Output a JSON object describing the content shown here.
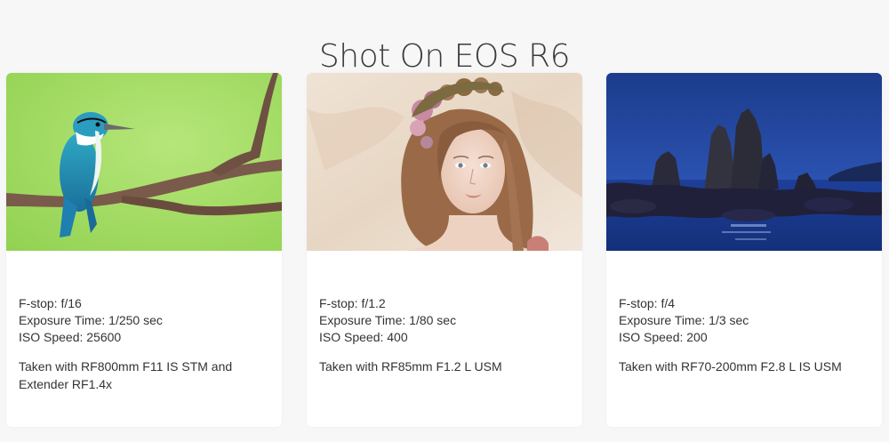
{
  "page": {
    "title": "Shot On EOS R6"
  },
  "cards": [
    {
      "image": "kingfisher-on-branch-photo",
      "fstop": "F-stop: f/16",
      "exposure": "Exposure Time: 1/250 sec",
      "iso": "ISO Speed: 25600",
      "lens": "Taken with RF800mm F11 IS STM and Extender RF1.4x"
    },
    {
      "image": "portrait-woman-flower-crown-photo",
      "fstop": "F-stop: f/1.2",
      "exposure": "Exposure Time: 1/80 sec",
      "iso": "ISO Speed: 400",
      "lens": "Taken with RF85mm F1.2 L USM"
    },
    {
      "image": "sea-rocks-at-night-photo",
      "fstop": "F-stop: f/4",
      "exposure": "Exposure Time: 1/3 sec",
      "iso": "ISO Speed: 200",
      "lens": "Taken with RF70-200mm F2.8 L IS USM"
    }
  ],
  "colors": {
    "background": "#f7f7f7",
    "card": "#ffffff",
    "text": "#333333"
  }
}
